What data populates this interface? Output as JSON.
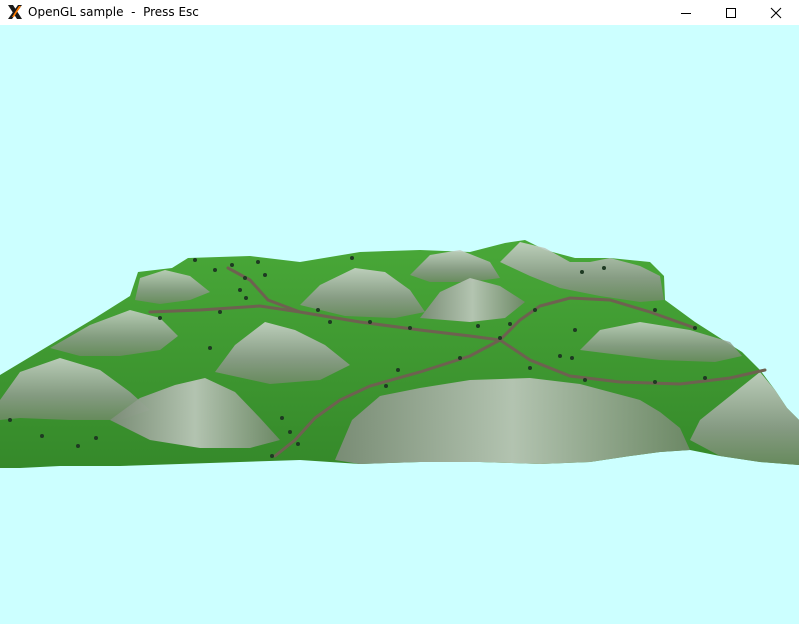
{
  "window": {
    "title": "OpenGL sample  -  Press Esc",
    "icon": "x-window-icon"
  },
  "titlebar_buttons": {
    "minimize": "minimize-icon",
    "maximize": "maximize-icon",
    "close": "close-icon"
  },
  "scene": {
    "sky_color": "#ccffff",
    "grass_color": "#3f9a2e",
    "mountain_color": "#9aa89a",
    "path_color": "#6e6150",
    "tree_color": "#1e3a22"
  }
}
